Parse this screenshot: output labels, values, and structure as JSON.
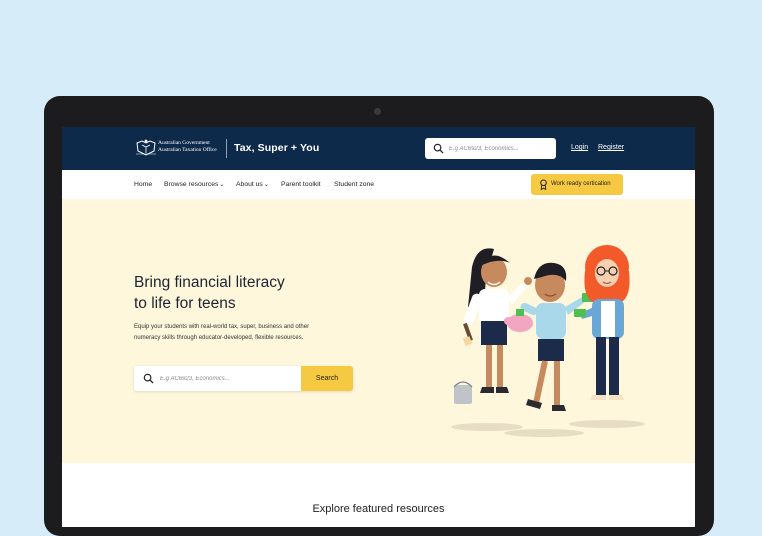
{
  "header": {
    "gov_line1": "Australian Government",
    "gov_line2": "Australian Taxation Office",
    "site_title": "Tax, Super + You",
    "search_placeholder": "E.g AC6923, Economics...",
    "login": "Login",
    "register": "Register"
  },
  "nav": {
    "items": [
      {
        "label": "Home"
      },
      {
        "label": "Browse resources",
        "chevron": "⌄"
      },
      {
        "label": "About us",
        "chevron": "⌄"
      },
      {
        "label": "Parent toolkit"
      },
      {
        "label": "Student zone"
      }
    ],
    "cta_label": "Work ready certication"
  },
  "hero": {
    "title_line1": "Bring financial literacy",
    "title_line2": "to life for teens",
    "subtitle_line1": "Equip your students with real-world tax, super, business and other",
    "subtitle_line2": "numeracy skills through educator-developed, flexible resources.",
    "search_placeholder": "E.g AC6923, Economics...",
    "search_button": "Search"
  },
  "featured": {
    "heading": "Explore featured resources"
  },
  "colors": {
    "page_bg": "#d6ecf9",
    "header_navy": "#0d2a4b",
    "accent_yellow": "#f6c943",
    "hero_cream": "#fef7dc"
  },
  "icons": [
    "crest-logo",
    "search-icon",
    "award-icon",
    "chevron-down-icon",
    "people-illustration"
  ]
}
